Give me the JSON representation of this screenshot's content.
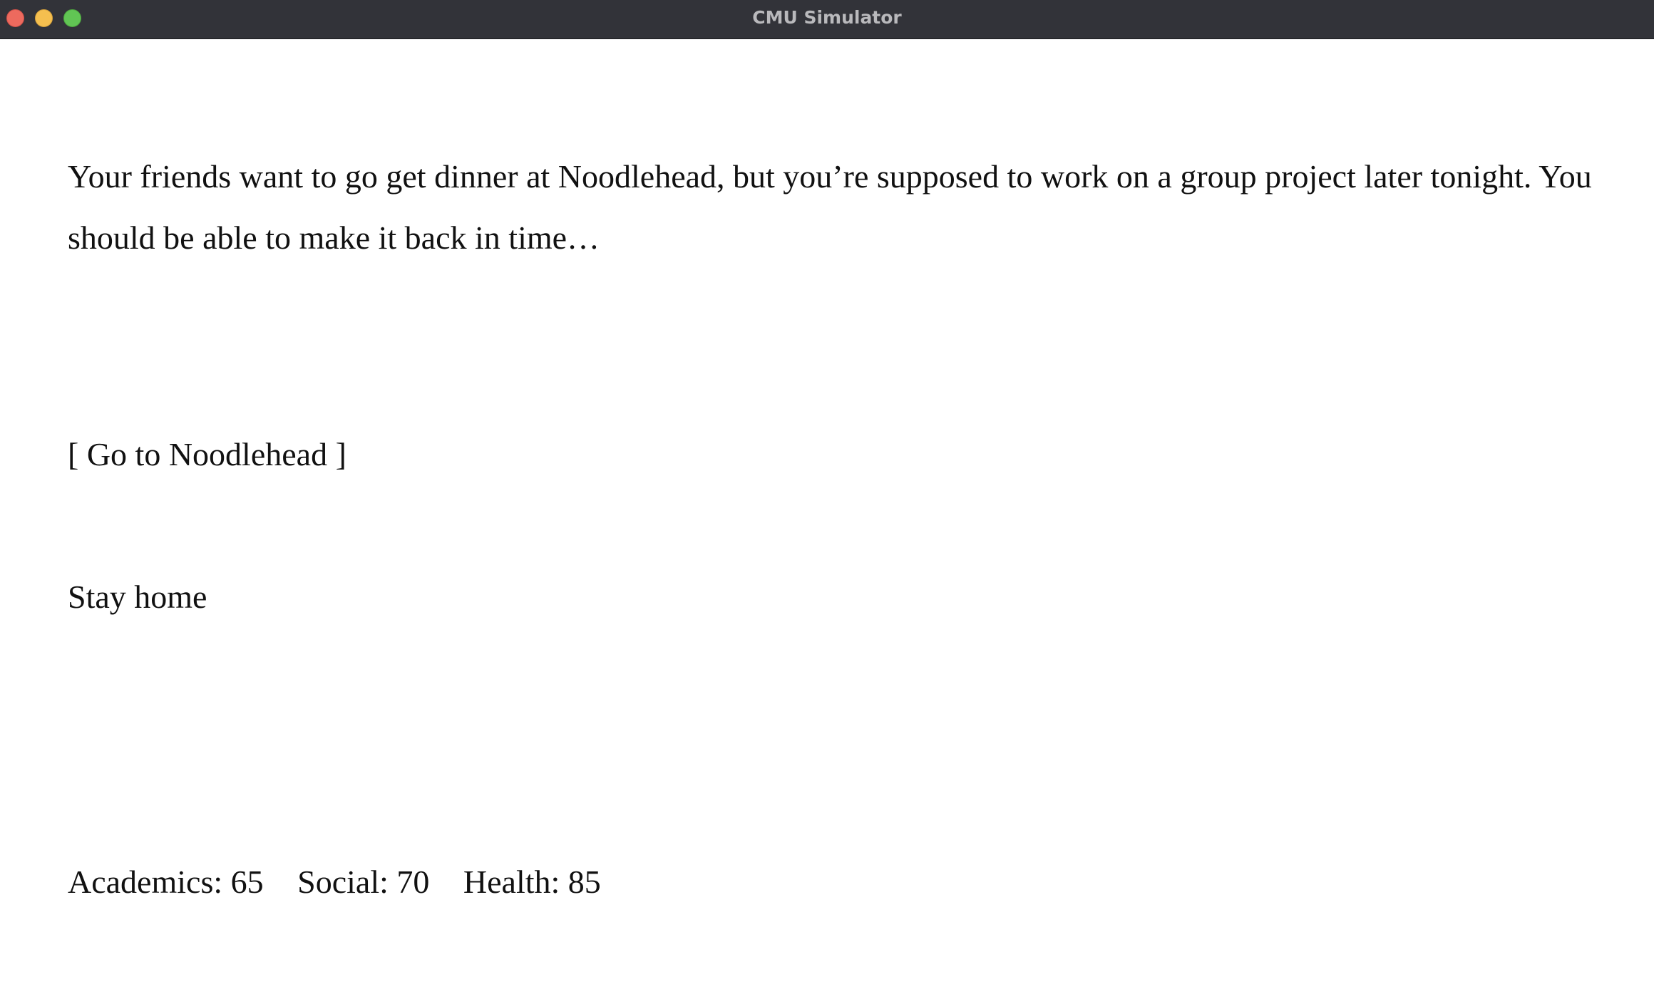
{
  "window": {
    "title": "CMU Simulator"
  },
  "story": {
    "text": "Your friends want to go get dinner at Noodlehead, but you’re supposed to work on a group project later tonight. You should be able to make it back in time…"
  },
  "choices": [
    {
      "label": "[ Go to Noodlehead ]",
      "selected": true
    },
    {
      "label": "Stay home",
      "selected": false
    }
  ],
  "stats": {
    "academics": "Academics: 65",
    "social": "Social: 70",
    "health": "Health: 85"
  },
  "colors": {
    "titlebar": "#323339",
    "title_text": "#b9b9bc",
    "close": "#ed6a5e",
    "minimize": "#f5bf4f",
    "zoom": "#61c554",
    "text": "#111111",
    "background": "#ffffff"
  }
}
